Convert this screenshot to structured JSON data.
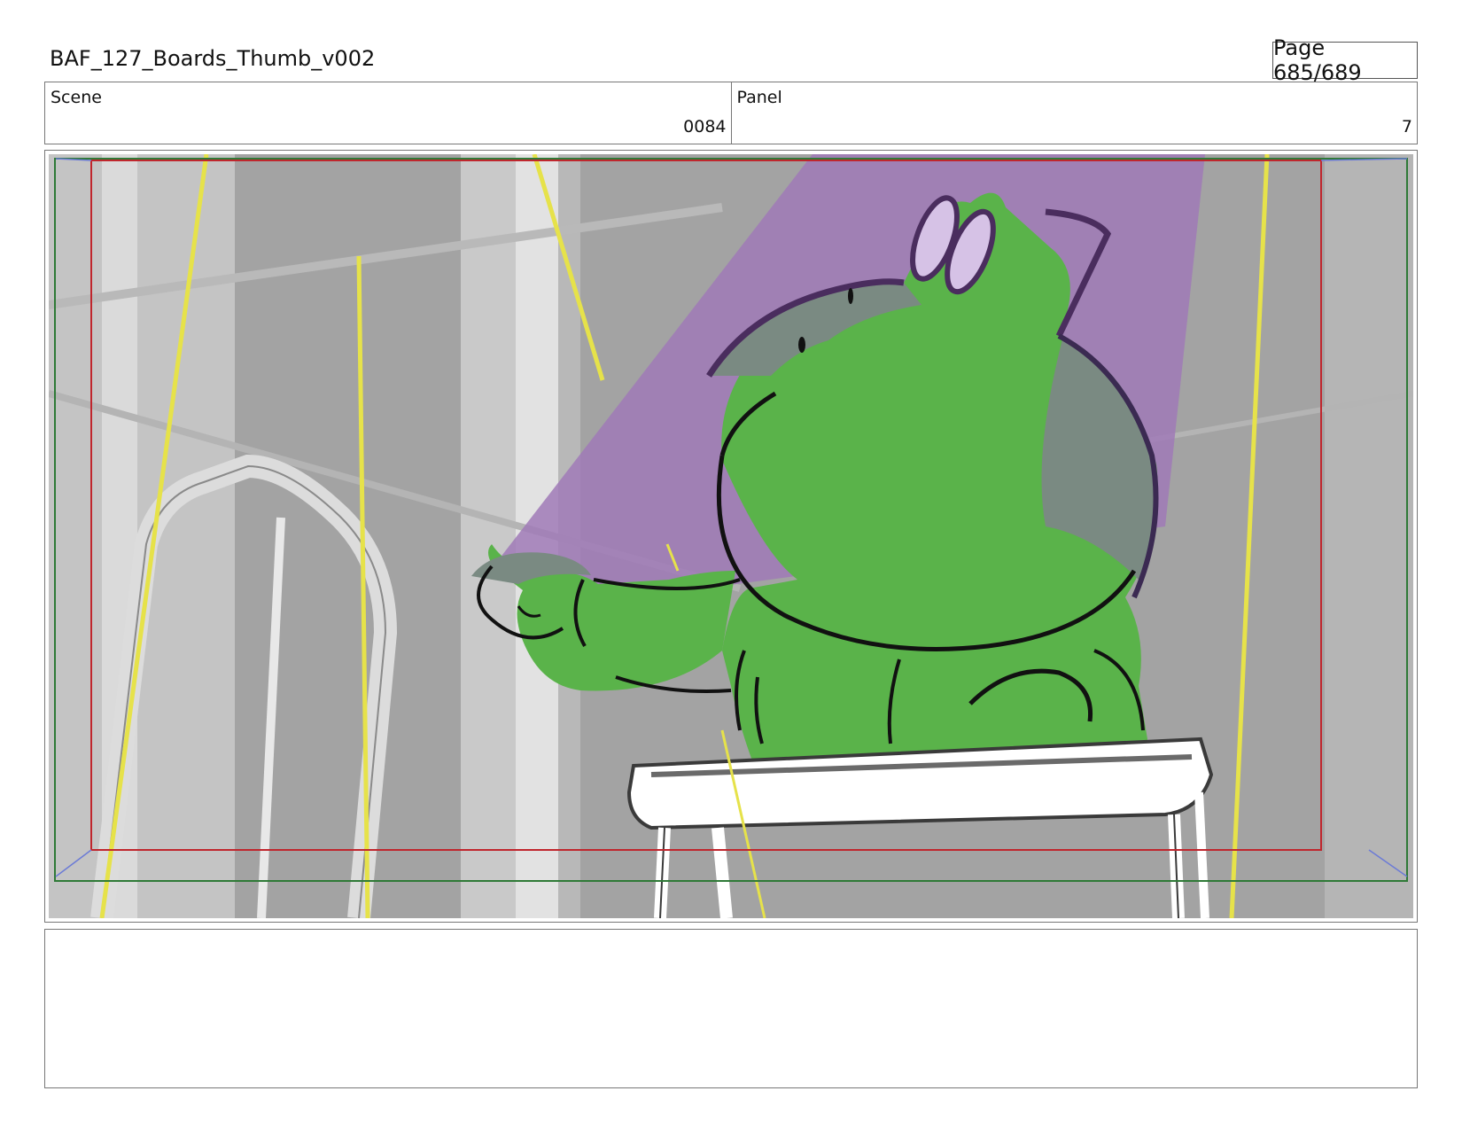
{
  "header": {
    "title": "BAF_127_Boards_Thumb_v002",
    "page": "Page 685/689"
  },
  "info": {
    "scene_label": "Scene",
    "scene_value": "0084",
    "panel_label": "Panel",
    "panel_value": "7"
  },
  "panel": {
    "colors": {
      "background": "#a3a3a3",
      "character": "#5ab34a",
      "spotlight": "#a07ab7",
      "outline": "#111111",
      "safe_frame": "#c0262d",
      "camera_frame": "#2f7a37",
      "yellow_line": "#e6e24a"
    }
  },
  "notes": {
    "text": ""
  }
}
